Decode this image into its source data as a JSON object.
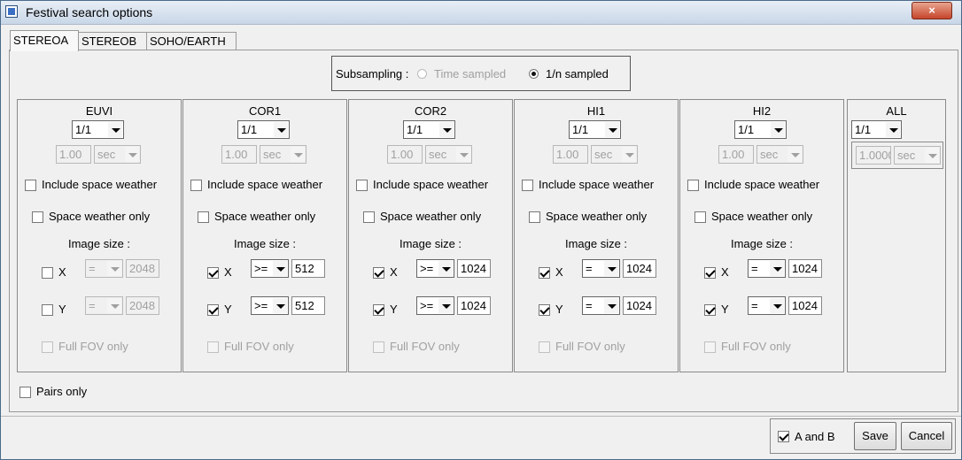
{
  "window": {
    "title": "Festival search options",
    "close_icon": "×"
  },
  "tabs": [
    "STEREOA",
    "STEREOB",
    "SOHO/EARTH"
  ],
  "subsampling": {
    "label": "Subsampling :",
    "option_time": "Time sampled",
    "option_1n": "1/n sampled",
    "selected": "1/n sampled"
  },
  "common": {
    "include_space_weather": "Include space weather",
    "space_weather_only": "Space weather only",
    "image_size": "Image size :",
    "x": "X",
    "y": "Y",
    "full_fov_only": "Full FOV only",
    "sec_value": "1.00",
    "sec_unit": "sec"
  },
  "instruments": [
    {
      "name": "EUVI",
      "ratio": "1/1",
      "x_checked": false,
      "x_op": "=",
      "x_val": "2048",
      "y_checked": false,
      "y_op": "=",
      "y_val": "2048"
    },
    {
      "name": "COR1",
      "ratio": "1/1",
      "x_checked": true,
      "x_op": ">=",
      "x_val": "512",
      "y_checked": true,
      "y_op": ">=",
      "y_val": "512"
    },
    {
      "name": "COR2",
      "ratio": "1/1",
      "x_checked": true,
      "x_op": ">=",
      "x_val": "1024",
      "y_checked": true,
      "y_op": ">=",
      "y_val": "1024"
    },
    {
      "name": "HI1",
      "ratio": "1/1",
      "x_checked": true,
      "x_op": "=",
      "x_val": "1024",
      "y_checked": true,
      "y_op": "=",
      "y_val": "1024"
    },
    {
      "name": "HI2",
      "ratio": "1/1",
      "x_checked": true,
      "x_op": "=",
      "x_val": "1024",
      "y_checked": true,
      "y_op": "=",
      "y_val": "1024"
    }
  ],
  "all": {
    "name": "ALL",
    "ratio": "1/1",
    "value": "1.0000",
    "unit": "sec"
  },
  "pairs_only": "Pairs only",
  "footer": {
    "a_and_b": "A and B",
    "a_and_b_checked": true,
    "save": "Save",
    "cancel": "Cancel"
  }
}
